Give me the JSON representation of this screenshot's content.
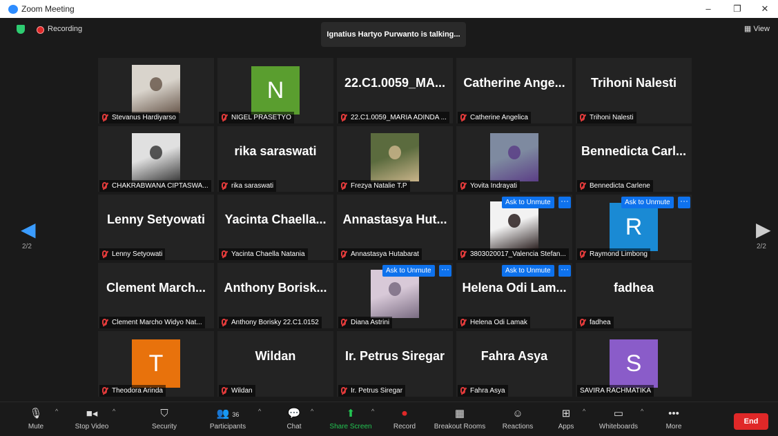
{
  "window": {
    "title": "Zoom Meeting",
    "minimize": "–",
    "maximize": "❐",
    "close": "✕"
  },
  "top": {
    "recording": "Recording",
    "talking": "Ignatius Hartyo Purwanto is talking...",
    "view": "View",
    "page_left": "2/2",
    "page_right": "2/2"
  },
  "unmute_label": "Ask to Unmute",
  "more_label": "···",
  "tiles": [
    {
      "name": "",
      "label": "Stevanus Hardiyarso",
      "type": "photo"
    },
    {
      "name": "",
      "label": "NIGEL PRASETYO",
      "type": "avatar",
      "letter": "N",
      "color": "#5a9e2f"
    },
    {
      "name": "22.C1.0059_MA...",
      "label": "22.C1.0059_MARIA ADINDA ...",
      "type": "text"
    },
    {
      "name": "Catherine Ange...",
      "label": "Catherine Angelica",
      "type": "text"
    },
    {
      "name": "Trihoni Nalesti",
      "label": "Trihoni Nalesti",
      "type": "text"
    },
    {
      "name": "",
      "label": "CHAKRABWANA CIPTASWA...",
      "type": "photo"
    },
    {
      "name": "rika saraswati",
      "label": "rika saraswati",
      "type": "text"
    },
    {
      "name": "",
      "label": "Frezya Natalie T.P",
      "type": "photo"
    },
    {
      "name": "",
      "label": "Yovita Indrayati",
      "type": "photo"
    },
    {
      "name": "Bennedicta Carl...",
      "label": "Bennedicta Carlene",
      "type": "text"
    },
    {
      "name": "Lenny Setyowati",
      "label": "Lenny Setyowati",
      "type": "text"
    },
    {
      "name": "Yacinta Chaella...",
      "label": "Yacinta Chaella Natania",
      "type": "text"
    },
    {
      "name": "Annastasya Hut...",
      "label": "Annastasya Hutabarat",
      "type": "text"
    },
    {
      "name": "",
      "label": "3803020017_Valencia Stefan...",
      "type": "photo",
      "unmute": true
    },
    {
      "name": "",
      "label": "Raymond Limbong",
      "type": "avatar",
      "letter": "R",
      "color": "#1a8ad4",
      "unmute": true
    },
    {
      "name": "Clement March...",
      "label": "Clement Marcho Widyo Nat...",
      "type": "text"
    },
    {
      "name": "Anthony Borisk...",
      "label": "Anthony Borisky 22.C1.0152",
      "type": "text"
    },
    {
      "name": "",
      "label": "Diana Astrini",
      "type": "photo",
      "unmute": true
    },
    {
      "name": "Helena Odi Lam...",
      "label": "Helena Odi Lamak",
      "type": "text",
      "unmute": true
    },
    {
      "name": "fadhea",
      "label": "fadhea",
      "type": "text"
    },
    {
      "name": "",
      "label": "Theodora Arinda",
      "type": "avatar",
      "letter": "T",
      "color": "#e8720c"
    },
    {
      "name": "Wildan",
      "label": "Wildan",
      "type": "text"
    },
    {
      "name": "Ir. Petrus Siregar",
      "label": "Ir. Petrus Siregar",
      "type": "text"
    },
    {
      "name": "Fahra Asya",
      "label": "Fahra Asya",
      "type": "text"
    },
    {
      "name": "",
      "label": "SAVIRA RACHMATIKA",
      "type": "avatar",
      "letter": "S",
      "color": "#8a5cc9",
      "nomic": true
    }
  ],
  "toolbar": {
    "mute": "Mute",
    "stop_video": "Stop Video",
    "security": "Security",
    "participants": "Participants",
    "participants_count": "36",
    "chat": "Chat",
    "share_screen": "Share Screen",
    "record": "Record",
    "breakout": "Breakout Rooms",
    "reactions": "Reactions",
    "apps": "Apps",
    "whiteboards": "Whiteboards",
    "more": "More",
    "end": "End"
  },
  "colors": {
    "share_green": "#23c552",
    "unmute_blue": "#0e72ed",
    "end_red": "#e02828"
  }
}
